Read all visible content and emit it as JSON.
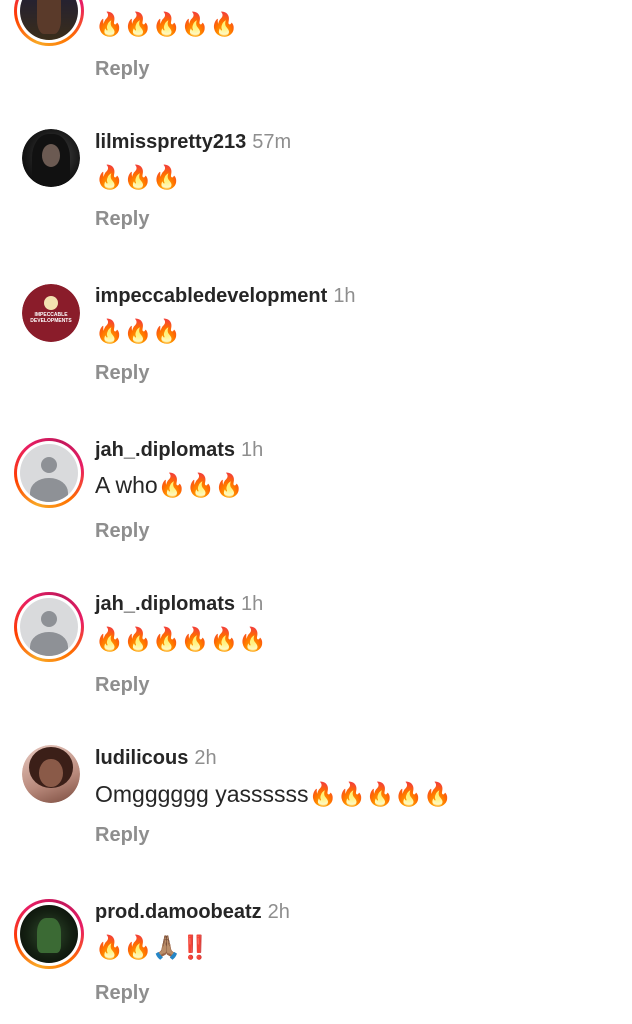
{
  "comments": [
    {
      "username": "",
      "time": "",
      "text": "🔥🔥🔥🔥🔥",
      "reply_label": "Reply",
      "avatar": "photo-top"
    },
    {
      "username": "lilmisspretty213",
      "time": "57m",
      "text": "🔥🔥🔥",
      "reply_label": "Reply",
      "avatar": "photo-dark"
    },
    {
      "username": "impeccabledevelopment",
      "time": "1h",
      "text": "🔥🔥🔥",
      "reply_label": "Reply",
      "avatar": "brand-logo",
      "avatar_text": "IMPECCABLE DEVELOPMENTS"
    },
    {
      "username": "jah_.diplomats",
      "time": "1h",
      "text": "A who🔥🔥🔥",
      "reply_label": "Reply",
      "avatar": "default-person"
    },
    {
      "username": "jah_.diplomats",
      "time": "1h",
      "text": "🔥🔥🔥🔥🔥🔥",
      "reply_label": "Reply",
      "avatar": "default-person"
    },
    {
      "username": "ludilicous",
      "time": "2h",
      "text": "Omgggggg yassssss🔥🔥🔥🔥🔥",
      "reply_label": "Reply",
      "avatar": "photo-lady"
    },
    {
      "username": "prod.damoobeatz",
      "time": "2h",
      "text": "🔥🔥🙏🏽‼️",
      "reply_label": "Reply",
      "avatar": "photo-green"
    }
  ],
  "colors": {
    "username": "#262626",
    "secondary": "#8e8e8e",
    "story_ring_start": "#f9a825",
    "story_ring_end": "#e91e63"
  }
}
